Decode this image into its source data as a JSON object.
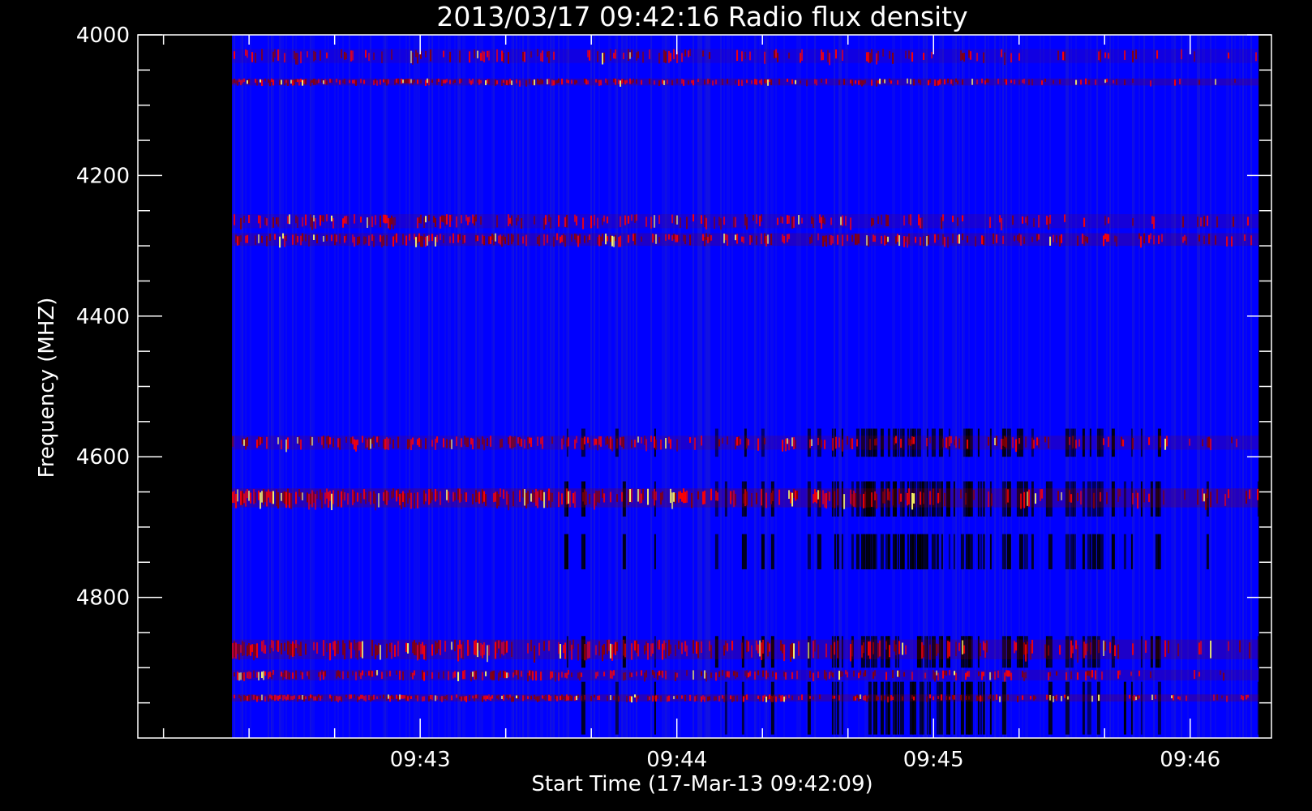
{
  "chart_data": {
    "type": "heatmap",
    "title": "2013/03/17 09:42:16 Radio flux density",
    "xlabel": "Start Time (17-Mar-13 09:42:09)",
    "ylabel": "Frequency (MHZ)",
    "x_range_seconds": [
      -15,
      250
    ],
    "ylim": [
      4000,
      5000
    ],
    "y_inverted": true,
    "data_time_span": [
      "09:42:16",
      "09:46:16"
    ],
    "x_ticks": [
      {
        "label": "09:43",
        "value": 51
      },
      {
        "label": "09:44",
        "value": 111
      },
      {
        "label": "09:45",
        "value": 171
      },
      {
        "label": "09:46",
        "value": 231
      }
    ],
    "x_minor_step": 20,
    "y_ticks": [
      {
        "label": "4000",
        "value": 4000
      },
      {
        "label": "4200",
        "value": 4200
      },
      {
        "label": "4400",
        "value": 4400
      },
      {
        "label": "4600",
        "value": 4600
      },
      {
        "label": "4800",
        "value": 4800
      }
    ],
    "y_minor_step": 50,
    "colormap": {
      "background": "#0000ff",
      "low": "#000000",
      "mid": "#8b0000",
      "high": "#ff0000",
      "peak": "#ffff66"
    },
    "bright_bands_mhz": [
      {
        "range": [
          4020,
          4040
        ],
        "intensity": 0.45
      },
      {
        "range": [
          4062,
          4072
        ],
        "intensity": 0.9
      },
      {
        "range": [
          4255,
          4275
        ],
        "intensity": 0.6
      },
      {
        "range": [
          4282,
          4300
        ],
        "intensity": 0.85
      },
      {
        "range": [
          4570,
          4590
        ],
        "intensity": 0.7
      },
      {
        "range": [
          4645,
          4672
        ],
        "intensity": 1.0
      },
      {
        "range": [
          4860,
          4888
        ],
        "intensity": 0.85
      },
      {
        "range": [
          4903,
          4918
        ],
        "intensity": 0.75
      },
      {
        "range": [
          4938,
          4948
        ],
        "intensity": 1.0
      }
    ],
    "dark_bands_mhz": [
      {
        "range": [
          4560,
          4600
        ],
        "intensity": 0.7
      },
      {
        "range": [
          4635,
          4685
        ],
        "intensity": 0.9
      },
      {
        "range": [
          4710,
          4760
        ],
        "intensity": 0.85
      },
      {
        "range": [
          4855,
          4900
        ],
        "intensity": 0.75
      },
      {
        "range": [
          4920,
          4995
        ],
        "intensity": 0.6
      }
    ]
  }
}
